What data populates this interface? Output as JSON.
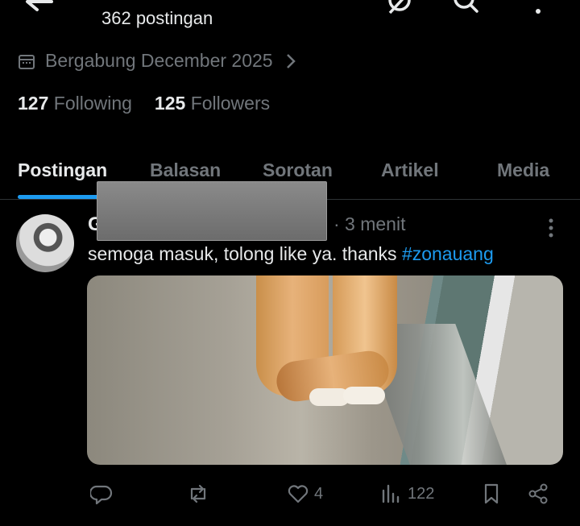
{
  "header": {
    "post_count": "362 postingan"
  },
  "profile": {
    "joined": "Bergabung December 2025",
    "following_count": "127",
    "following_label": "Following",
    "followers_count": "125",
    "followers_label": "Followers"
  },
  "tabs": [
    {
      "label": "Postingan",
      "active": true
    },
    {
      "label": "Balasan",
      "active": false
    },
    {
      "label": "Sorotan",
      "active": false
    },
    {
      "label": "Artikel",
      "active": false
    },
    {
      "label": "Media",
      "active": false
    }
  ],
  "post": {
    "name_initial": "G",
    "time": "· 3 menit",
    "text": "semoga masuk, tolong like ya. thanks",
    "hashtag": "#zonauang",
    "likes": "4",
    "views": "122"
  },
  "colors": {
    "background": "#000000",
    "text": "#e7e9ea",
    "muted": "#71767b",
    "accent": "#1d9bf0"
  },
  "icons": [
    "back-arrow-icon",
    "grok-icon",
    "search-icon",
    "more-vertical-icon",
    "calendar-icon",
    "chevron-right-icon",
    "reply-icon",
    "repost-icon",
    "like-icon",
    "views-icon",
    "bookmark-icon",
    "share-icon"
  ]
}
